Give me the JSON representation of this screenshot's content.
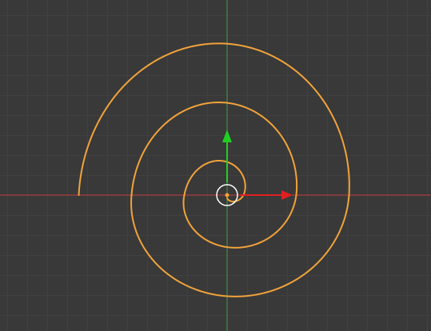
{
  "viewport": {
    "background_color": "#393939",
    "grid_minor_color": "#404040",
    "grid_major_color": "#424242",
    "x_axis_color": "#c23a3a",
    "y_axis_color": "#3f9a3f",
    "curve_color": "#f2a33a"
  },
  "objects": [
    {
      "type": "curve-spiral",
      "selected": true,
      "turns": 2.75,
      "direction": "counter-clockwise-outward",
      "end_angle_deg": 180
    }
  ],
  "gizmo": {
    "type": "translate",
    "x_handle_color": "#e02020",
    "y_handle_color": "#20d020",
    "pivot_ring_color": "#ffffff",
    "origin_dot_color": "#f2a33a"
  }
}
